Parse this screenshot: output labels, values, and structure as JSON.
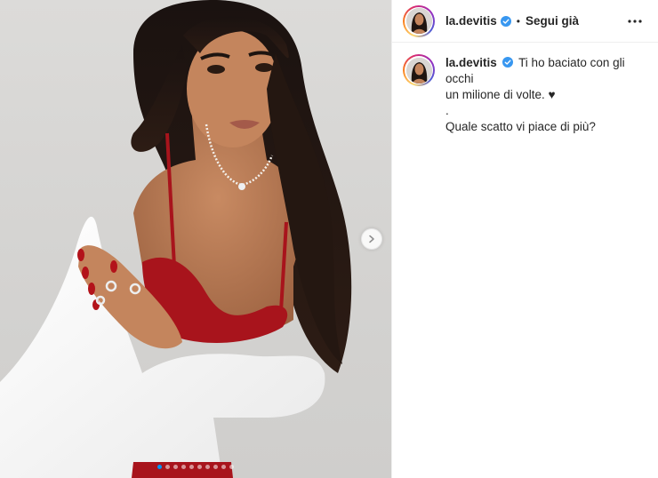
{
  "post": {
    "author": {
      "username": "la.devitis",
      "verified": true
    },
    "header": {
      "separator": "•",
      "follow_state": "Segui già"
    },
    "caption": {
      "text_line1": "Ti ho baciato con gli occhi",
      "text_line2": "un milione di volte. ♥",
      "text_line3": ".",
      "text_line4": "Quale scatto vi piace di più?"
    },
    "carousel": {
      "total_slides": 10,
      "active_index": 0
    },
    "colors": {
      "active_dot": "#0095f6",
      "verified_badge": "#3897f0",
      "lingerie": "#a8141c",
      "jacket": "#fbfbfb"
    }
  }
}
